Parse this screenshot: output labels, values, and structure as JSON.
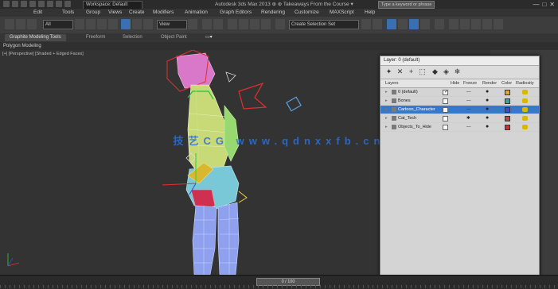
{
  "titlebar": {
    "workspace": "Workspace: Default",
    "app_title": "Autodesk 3ds Max 2013    ⊕ ⊕ Takeaways From the Course ▾",
    "search_placeholder": "Type a keyword or phrase",
    "controls": [
      "—",
      "□",
      "✕"
    ]
  },
  "menubar": {
    "items": [
      "Edit",
      "Tools",
      "Group",
      "Views",
      "Create",
      "Modifiers",
      "Animation",
      "Graph Editors",
      "Rendering",
      "Customize",
      "MAXScript",
      "Help"
    ]
  },
  "toolbar": {
    "filter_value": "All",
    "view_value": "View",
    "selection_set": "Create Selection Set"
  },
  "ribbon": {
    "tabs": [
      "Graphite Modeling Tools",
      "Freeform",
      "Selection",
      "Object Paint"
    ],
    "panel_label": "Polygon Modeling"
  },
  "viewport": {
    "label": "[+] [Perspective] [Shaded + Edged Faces]",
    "watermark": "技艺CG www.qdnxxfb.cn"
  },
  "layer_window": {
    "title": "Layer: 0 (default)",
    "columns": [
      "Layers",
      "Hide",
      "Freeze",
      "Render",
      "Color",
      "Radiosity"
    ],
    "rows": [
      {
        "name": "0 (default)",
        "hide": "✓",
        "freeze": "—",
        "render": "●",
        "color": "#e8a030",
        "selected": false
      },
      {
        "name": "Bones",
        "hide": "",
        "freeze": "—",
        "render": "●",
        "color": "#3aa0a0",
        "selected": false
      },
      {
        "name": "Cartoon_Character",
        "hide": "",
        "freeze": "—",
        "render": "●",
        "color": "#3050d0",
        "selected": true
      },
      {
        "name": "Cat_Tech",
        "hide": "",
        "freeze": "✱",
        "render": "●",
        "color": "#d04040",
        "selected": false
      },
      {
        "name": "Objects_To_Hide",
        "hide": "",
        "freeze": "—",
        "render": "●",
        "color": "#d03030",
        "selected": false
      }
    ]
  },
  "status": {
    "time_slider": "0 / 100"
  }
}
